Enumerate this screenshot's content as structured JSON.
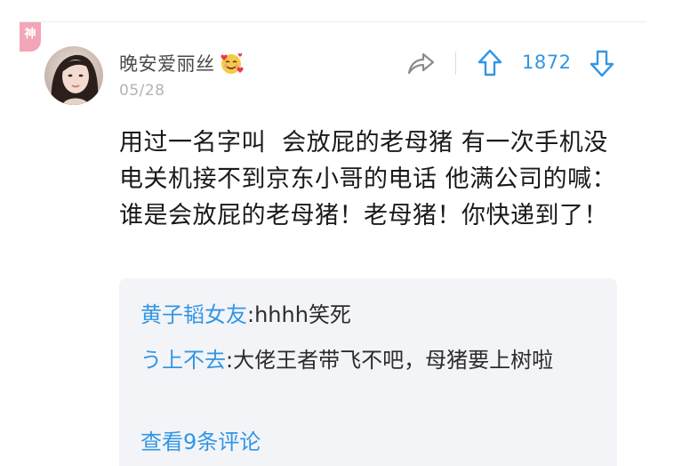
{
  "badge": {
    "label": "神",
    "color": "#f3a6b8"
  },
  "post": {
    "author": {
      "name": "晚安爱丽丝",
      "emoji": "smiling-face-with-hearts-icon",
      "avatar": "avatar-photo"
    },
    "date": "05/28",
    "votes": {
      "count": "1872"
    },
    "icons": {
      "share": "share-arrow-icon",
      "upvote": "arrow-up-icon",
      "downvote": "arrow-down-icon"
    },
    "content": "用过一名字叫  会放屁的老母猪 有一次手机没电关机接不到京东小哥的电话 他满公司的喊：谁是会放屁的老母猪！老母猪！你快递到了！"
  },
  "replies": {
    "items": [
      {
        "author": "黄子韬女友",
        "separator": ":",
        "text": "hhhh笑死"
      },
      {
        "author": "う上不去",
        "separator": ":",
        "text": "大佬王者带飞不吧，母猪要上树啦"
      }
    ],
    "view_more": "查看9条评论"
  },
  "colors": {
    "accent": "#3296e4",
    "muted": "#b3b3b3",
    "reply_background": "#f3f4f8"
  }
}
